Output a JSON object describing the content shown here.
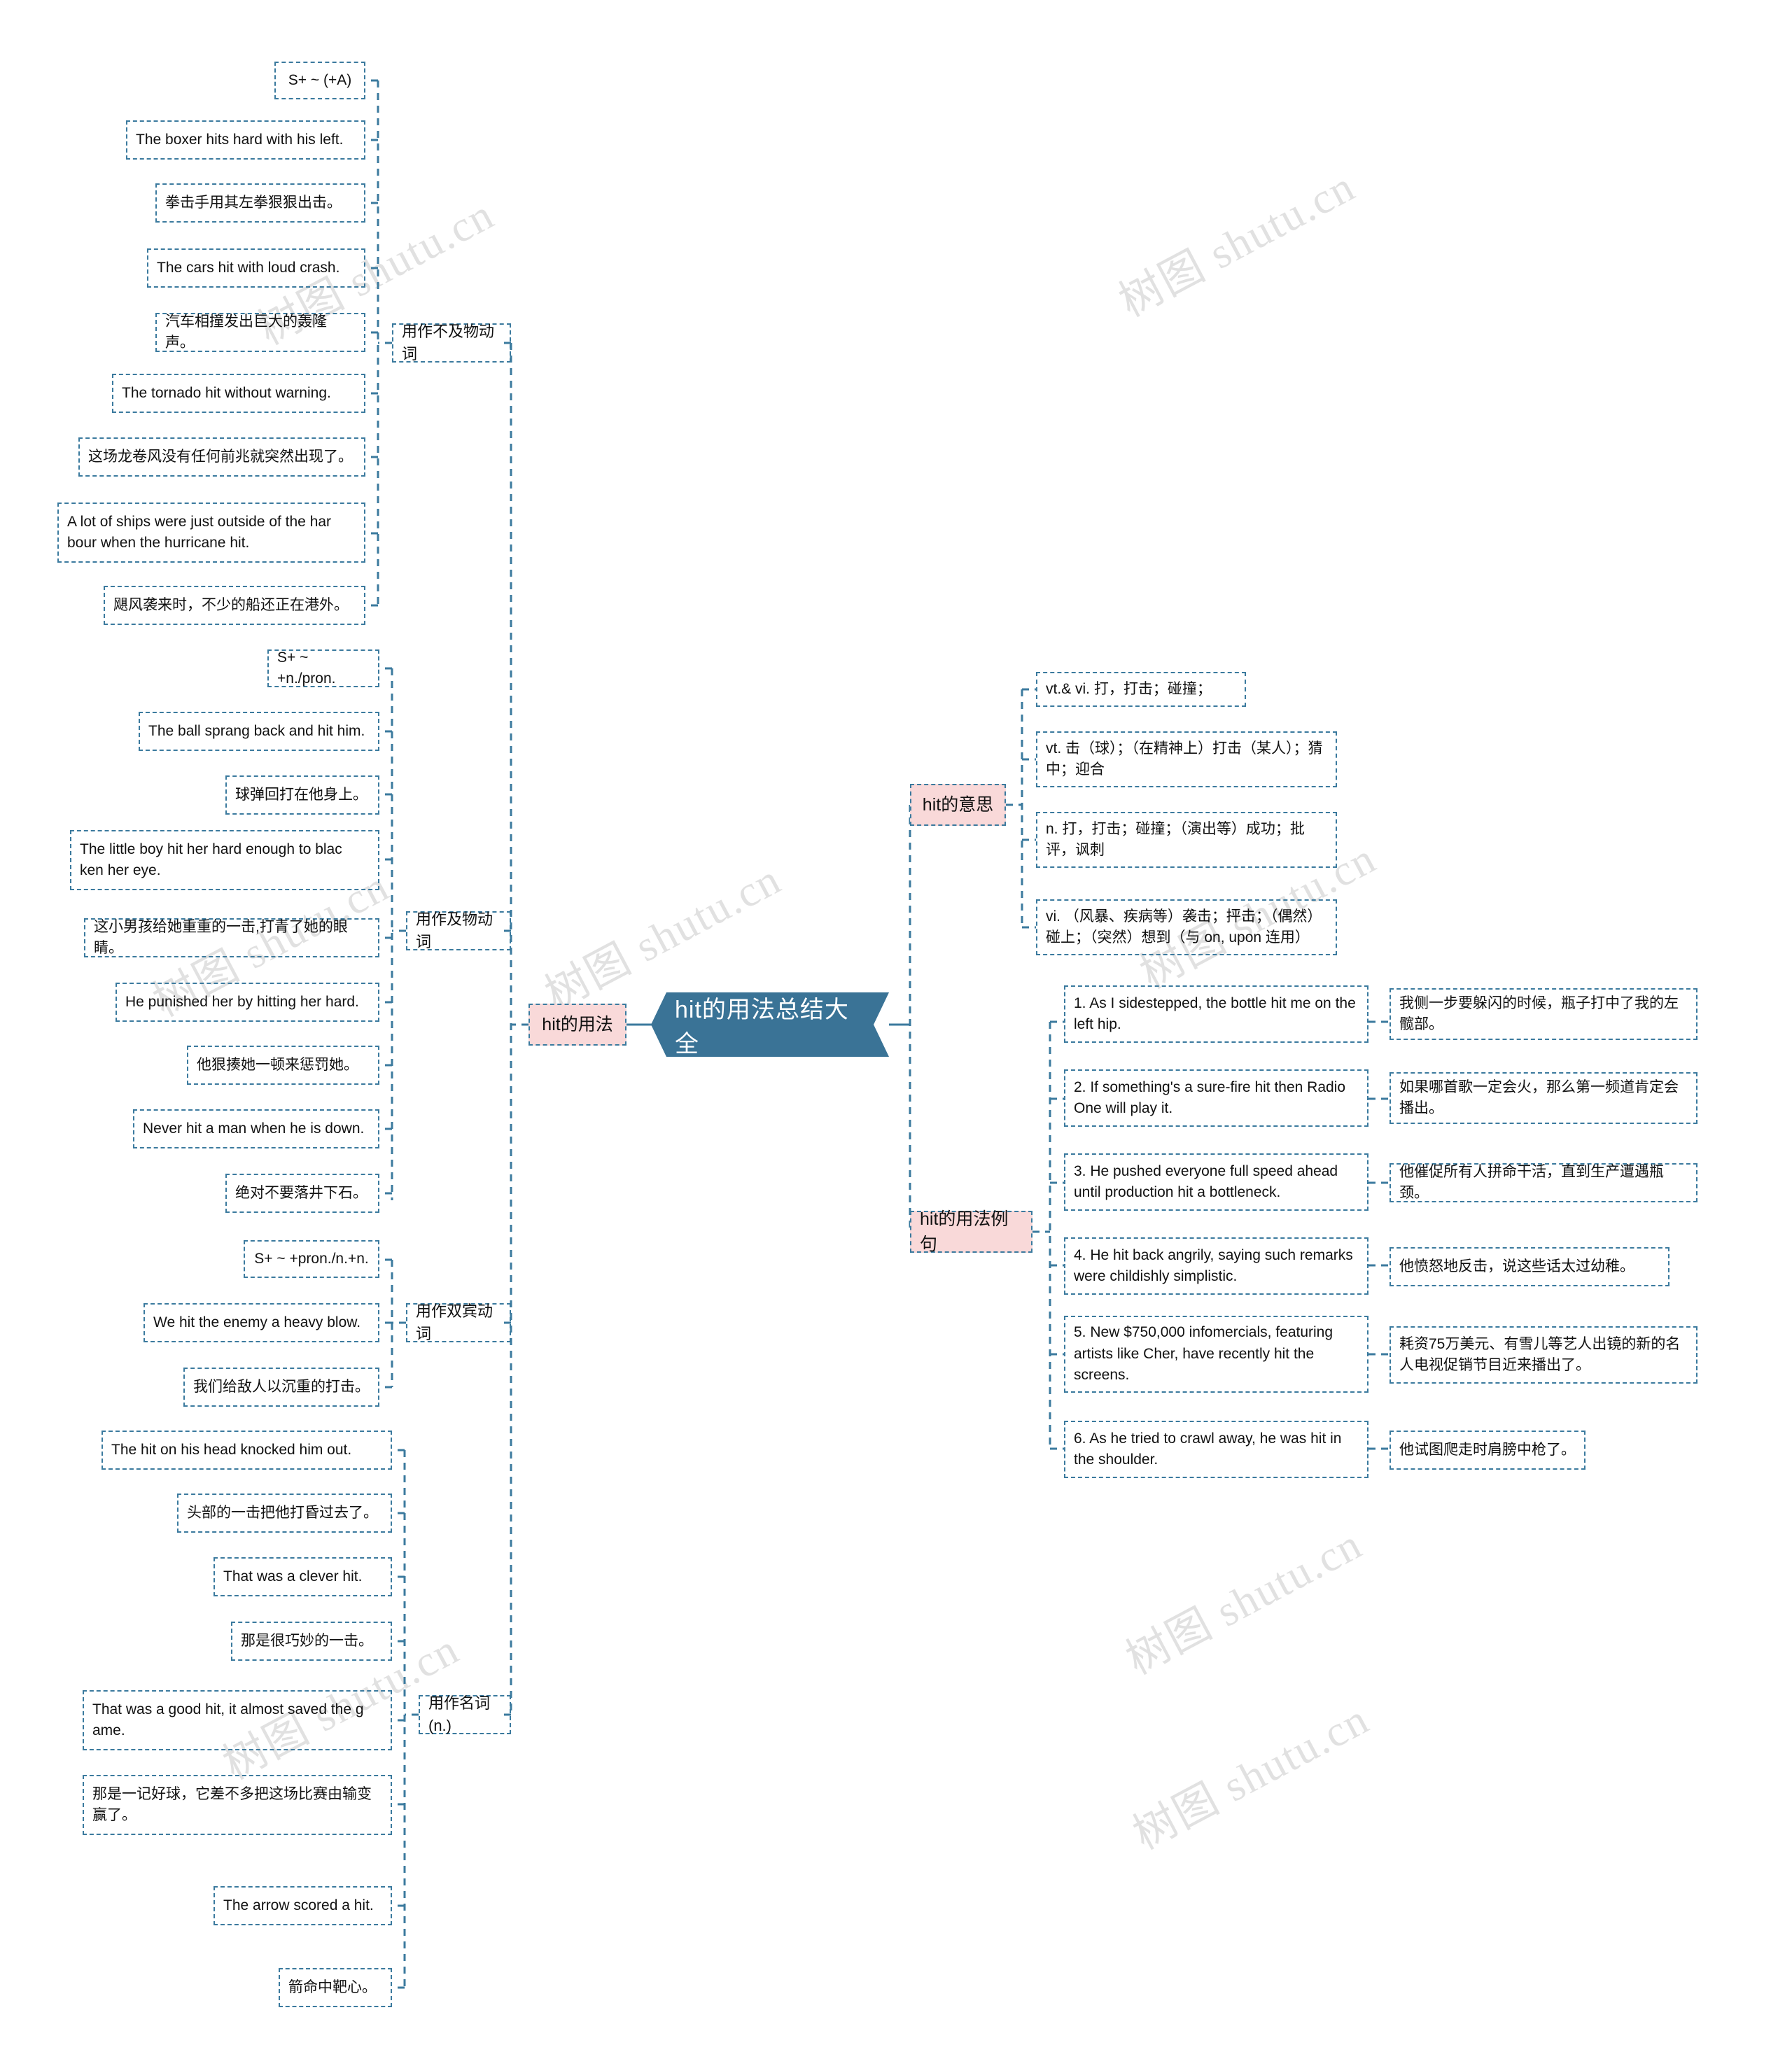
{
  "root": {
    "title": "hit的用法总结大全"
  },
  "watermarks": [
    "树图 shutu.cn",
    "树图 shutu.cn",
    "树图 shutu.cn",
    "树图 shutu.cn",
    "树图 shutu.cn",
    "树图 shutu.cn",
    "树图 shutu.cn",
    "树图 shutu.cn"
  ],
  "colors": {
    "root_fill": "#3a7396",
    "root_text": "#ffffff",
    "label_fill": "#f9d9d9",
    "border": "#3b7a9e",
    "text": "#111111",
    "watermark": "#c9c9c9"
  },
  "branches": {
    "usage": {
      "label": "hit的用法"
    },
    "meaning": {
      "label": "hit的意思"
    },
    "examples": {
      "label": "hit的用法例句"
    }
  },
  "usage_groups": [
    {
      "label": "用作不及物动词",
      "items": [
        "S+ ~ (+A)",
        "The boxer hits hard with his left.",
        "拳击手用其左拳狠狠出击。",
        "The cars hit with loud crash.",
        "汽车相撞发出巨大的轰隆声。",
        "The tornado hit without warning.",
        "这场龙卷风没有任何前兆就突然出现了。",
        "A lot of ships were just outside of the har bour when the hurricane hit.",
        "飓风袭来时，不少的船还正在港外。"
      ]
    },
    {
      "label": "用作及物动词",
      "items": [
        "S+ ~ +n./pron.",
        "The ball sprang back and hit him.",
        "球弹回打在他身上。",
        "The little boy hit her hard enough to blac ken her eye.",
        "这小男孩给她重重的一击,打青了她的眼睛。",
        "He punished her by hitting her hard.",
        "他狠揍她一顿来惩罚她。",
        "Never hit a man when he is down.",
        "绝对不要落井下石。"
      ]
    },
    {
      "label": "用作双宾动词",
      "items": [
        "S+ ~ +pron./n.+n.",
        "We hit the enemy a heavy blow.",
        "我们给敌人以沉重的打击。"
      ]
    },
    {
      "label": "用作名词(n.)",
      "items": [
        "The hit on his head knocked him out.",
        "头部的一击把他打昏过去了。",
        "That was a clever hit.",
        "那是很巧妙的一击。",
        "That was a good hit, it almost saved the g ame.",
        "那是一记好球，它差不多把这场比赛由输变赢了。",
        "The arrow scored a hit.",
        "箭命中靶心。"
      ]
    }
  ],
  "meanings": [
    "vt.& vi. 打，打击；碰撞；",
    "vt. 击（球）；（在精神上）打击（某人）；猜中；迎合",
    "n. 打，打击；碰撞；（演出等）成功；批评，讽刺",
    "vi. （风暴、疾病等）袭击；抨击；（偶然）碰上；（突然）想到（与 on, upon 连用）"
  ],
  "examples": [
    {
      "en": "1. As I sidestepped, the bottle hit me on the left hip.",
      "zh": "我侧一步要躲闪的时候，瓶子打中了我的左髋部。"
    },
    {
      "en": "2. If something's a sure-fire hit then Radio One will play it.",
      "zh": "如果哪首歌一定会火，那么第一频道肯定会播出。"
    },
    {
      "en": "3. He pushed everyone full speed ahead until production hit a bottleneck.",
      "zh": "他催促所有人拼命干活，直到生产遭遇瓶颈。"
    },
    {
      "en": "4. He hit back angrily, saying such remarks were childishly simplistic.",
      "zh": "他愤怒地反击，说这些话太过幼稚。"
    },
    {
      "en": "5. New $750,000 infomercials, featuring artists like Cher, have recently hit the screens.",
      "zh": "耗资75万美元、有雪儿等艺人出镜的新的名人电视促销节目近来播出了。"
    },
    {
      "en": "6. As he tried to crawl away, he was hit in the shoulder.",
      "zh": "他试图爬走时肩膀中枪了。"
    }
  ]
}
